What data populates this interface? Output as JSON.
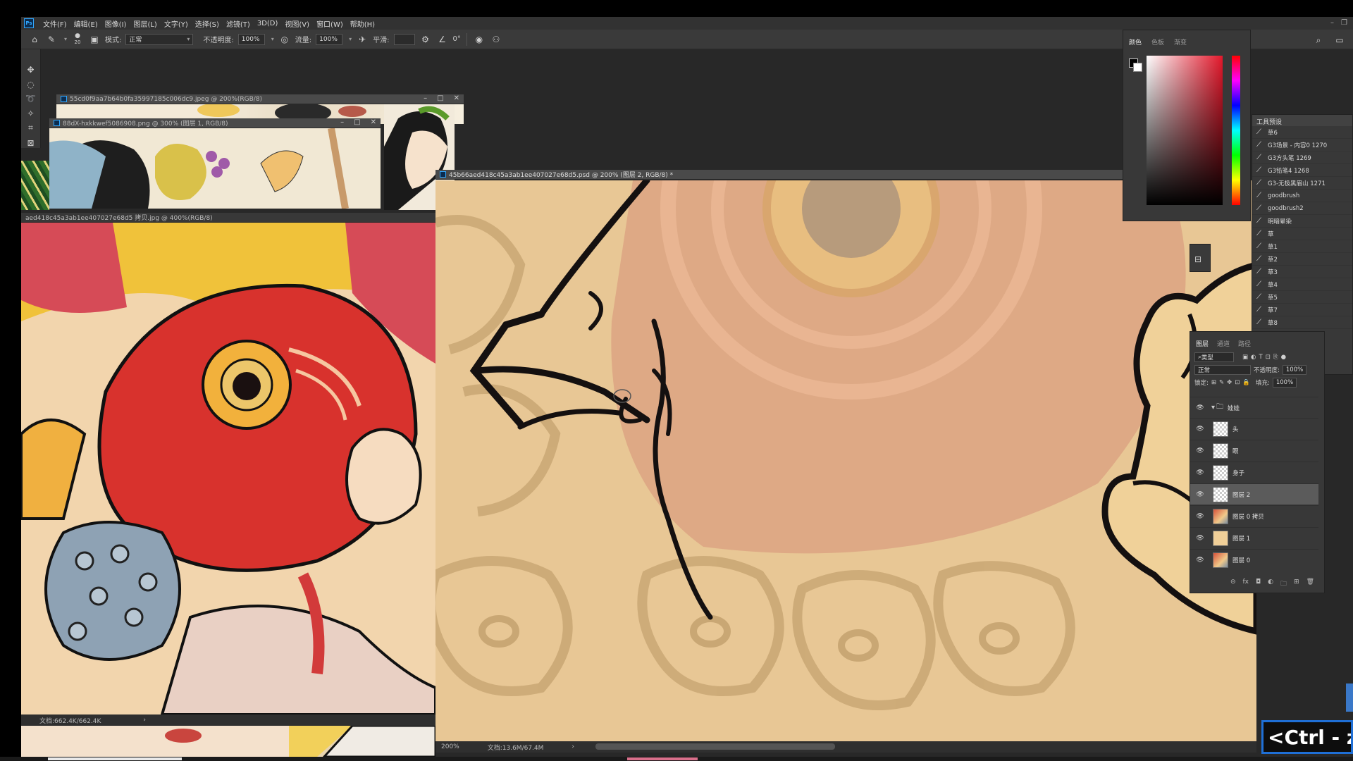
{
  "menubar": {
    "logo": "Ps",
    "items": [
      "文件(F)",
      "编辑(E)",
      "图像(I)",
      "图层(L)",
      "文字(Y)",
      "选择(S)",
      "滤镜(T)",
      "3D(D)",
      "视图(V)",
      "窗口(W)",
      "帮助(H)"
    ]
  },
  "options": {
    "brush_size": "20",
    "mode_label": "模式:",
    "mode_value": "正常",
    "opacity_label": "不透明度:",
    "opacity_value": "100%",
    "flow_label": "流量:",
    "flow_value": "100%",
    "smooth_label": "平滑:",
    "angle_value": "0°"
  },
  "documents": {
    "doc1_title": "55cd0f9aa7b64b0fa35997185c006dc9.jpeg @ 200%(RGB/8)",
    "doc2_title": "88dX-hxkkwef5086908.png @ 300% (图层 1, RGB/8)",
    "doc3_title": "aed418c45a3ab1ee407027e68d5 拷贝.jpg @ 400%(RGB/8)",
    "doc3_status": "文档:662.4K/662.4K",
    "doc5_title": "45b66aed418c45a3ab1ee407027e68d5.psd @ 200% (图层 2, RGB/8) *",
    "doc5_zoom": "200%",
    "doc5_status": "文档:13.6M/67.4M"
  },
  "color_panel": {
    "tabs": [
      "颜色",
      "色板",
      "渐变"
    ],
    "foreground": "#000000",
    "background": "#ffffff",
    "hue_color": "#e3182b"
  },
  "presets_panel": {
    "title": "工具预设",
    "items": [
      "草6",
      "G3场景 - 内容0 1270",
      "G3方头笔 1269",
      "G3铅笔4 1268",
      "G3-无极黑眉山 1271",
      "goodbrush",
      "goodbrush2",
      "明暗晕染",
      "草",
      "草1",
      "草2",
      "草3",
      "草4",
      "草5",
      "草7",
      "草8"
    ]
  },
  "layers_panel": {
    "tabs": [
      "图层",
      "通道",
      "路径"
    ],
    "filter_kind": "类型",
    "blend_mode": "正常",
    "opacity_label": "不透明度:",
    "opacity_value": "100%",
    "lock_label": "锁定:",
    "fill_label": "填充:",
    "fill_value": "100%",
    "group_name": "娃娃",
    "layers": [
      {
        "name": "头",
        "thumb": "transparent"
      },
      {
        "name": "眼",
        "thumb": "transparent"
      },
      {
        "name": "身子",
        "thumb": "transparent"
      },
      {
        "name": "图层 2",
        "thumb": "transparent",
        "selected": true
      },
      {
        "name": "图层 0 拷贝",
        "thumb": "art"
      },
      {
        "name": "图层 1",
        "thumb": "tan"
      },
      {
        "name": "图层 0",
        "thumb": "art"
      }
    ]
  },
  "overlay": {
    "hotkey": "<Ctrl - z>"
  }
}
